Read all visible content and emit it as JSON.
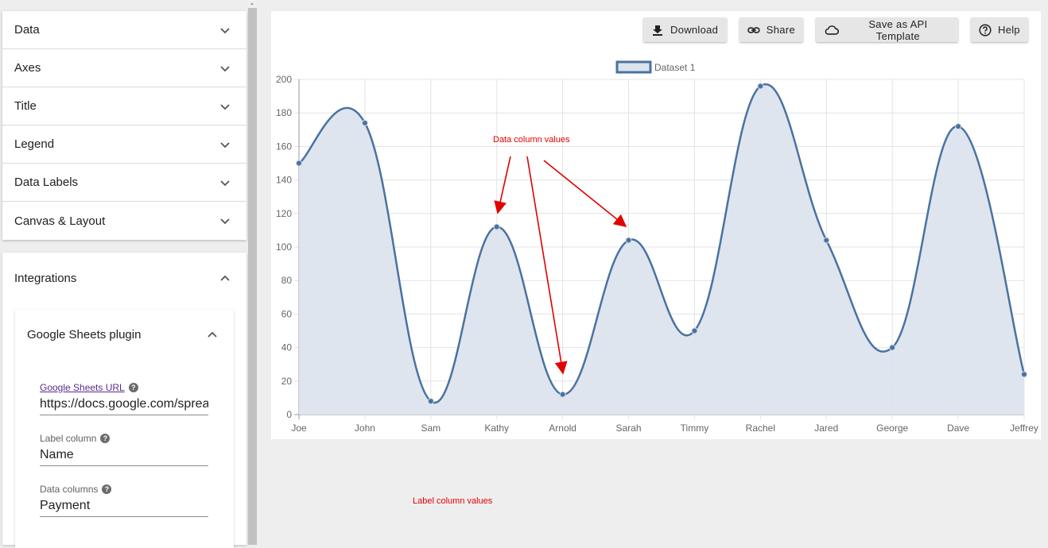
{
  "sidebar": {
    "accordion": [
      {
        "label": "Data"
      },
      {
        "label": "Axes"
      },
      {
        "label": "Title"
      },
      {
        "label": "Legend"
      },
      {
        "label": "Data Labels"
      },
      {
        "label": "Canvas & Layout"
      }
    ],
    "integrations": {
      "label": "Integrations",
      "plugin": {
        "label": "Google Sheets plugin",
        "url_label": "Google Sheets URL",
        "url_value": "https://docs.google.com/spreadsheets",
        "label_column_label": "Label column",
        "label_column_value": "Name",
        "data_columns_label": "Data columns",
        "data_columns_value": "Payment"
      }
    }
  },
  "toolbar": {
    "download": "Download",
    "share": "Share",
    "save_template": "Save as API Template",
    "help": "Help"
  },
  "annotations": {
    "data_column": "Data column values",
    "label_column": "Label column values"
  },
  "colors": {
    "line": "#4a72a0",
    "fill": "#dce4ed",
    "annotation": "#e00000"
  },
  "chart_data": {
    "type": "area",
    "categories": [
      "Joe",
      "John",
      "Sam",
      "Kathy",
      "Arnold",
      "Sarah",
      "Timmy",
      "Rachel",
      "Jared",
      "George",
      "Dave",
      "Jeffrey"
    ],
    "series": [
      {
        "name": "Dataset 1",
        "values": [
          150,
          174,
          8,
          112,
          12,
          104,
          50,
          196,
          104,
          40,
          172,
          24
        ]
      }
    ],
    "ylim": [
      0,
      200
    ],
    "yticks": [
      0,
      20,
      40,
      60,
      80,
      100,
      120,
      140,
      160,
      180,
      200
    ],
    "legend": "top-center",
    "grid": true,
    "smooth": true
  }
}
